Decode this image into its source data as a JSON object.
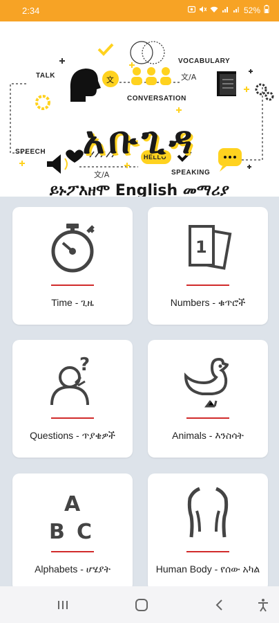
{
  "status_bar": {
    "time": "2:34",
    "battery": "52%",
    "icons": [
      "photo-icon",
      "mute-icon",
      "wifi-icon",
      "signal-icon",
      "signal-icon",
      "battery-icon"
    ]
  },
  "banner": {
    "title": "አቡጊዳ",
    "subtitle": "ይኑፖእዘሞ English መማሪያ",
    "labels": {
      "talk": "TALK",
      "conversation": "CONVERSATION",
      "vocabulary": "VOCABULARY",
      "speech": "SPEECH",
      "speaking": "SPEAKING",
      "hello": "HELLO"
    },
    "accent_color": "#ffd21f"
  },
  "categories": [
    {
      "label": "Time - ጊዜ",
      "icon": "stopwatch-icon"
    },
    {
      "label": "Numbers - ቁጥሮች",
      "icon": "number-cards-icon"
    },
    {
      "label": "Questions - ጥያቄዎች",
      "icon": "question-person-icon"
    },
    {
      "label": "Animals - እንስሳት",
      "icon": "duck-icon"
    },
    {
      "label": "Alphabets - ሆሄያት",
      "icon": "abc-icon"
    },
    {
      "label": "Human Body - የሰው አካል",
      "icon": "human-torso-icon"
    }
  ],
  "navbar": {
    "icons": [
      "recent-apps-icon",
      "home-icon",
      "back-icon",
      "accessibility-icon"
    ]
  },
  "colors": {
    "status_bar": "#f7a325",
    "card_rule": "#d12a2a",
    "background": "#dde3ea"
  }
}
